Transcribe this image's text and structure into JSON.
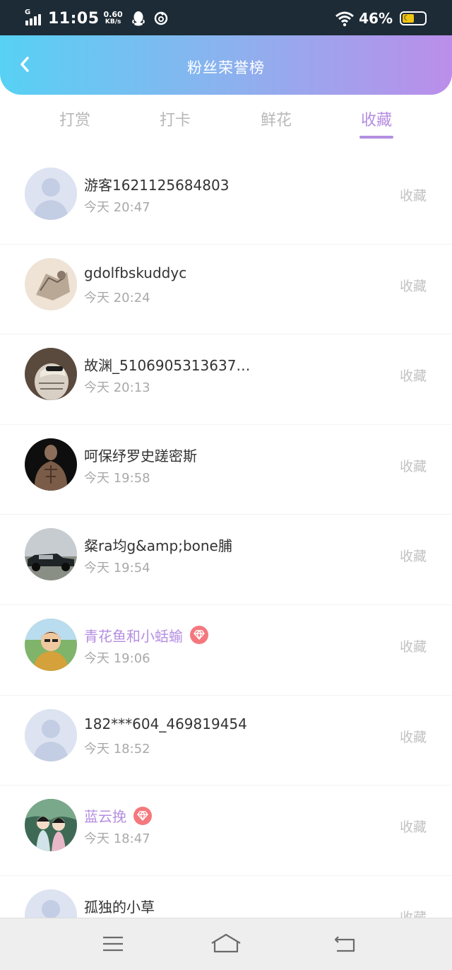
{
  "status_bar": {
    "network": "G",
    "time": "11:05",
    "speed_value": "0.60",
    "speed_unit": "KB/s",
    "battery": "46%"
  },
  "header": {
    "title": "粉丝荣誉榜"
  },
  "tabs": [
    {
      "label": "打赏",
      "active": false
    },
    {
      "label": "打卡",
      "active": false
    },
    {
      "label": "鲜花",
      "active": false
    },
    {
      "label": "收藏",
      "active": true
    }
  ],
  "list": [
    {
      "name": "游客1621125684803",
      "time": "今天 20:47",
      "action": "收藏",
      "vip": false
    },
    {
      "name": "gdolfbskuddyc",
      "time": "今天 20:24",
      "action": "收藏",
      "vip": false
    },
    {
      "name": "故渊_5106905313637…",
      "time": "今天 20:13",
      "action": "收藏",
      "vip": false
    },
    {
      "name": "呵保纾罗史蹉密斯",
      "time": "今天 19:58",
      "action": "收藏",
      "vip": false
    },
    {
      "name": "粲ra均g&amp;bone脯",
      "time": "今天 19:54",
      "action": "收藏",
      "vip": false
    },
    {
      "name": "青花鱼和小蛞蝓",
      "time": "今天 19:06",
      "action": "收藏",
      "vip": true
    },
    {
      "name": "182***604_469819454",
      "time": "今天 18:52",
      "action": "收藏",
      "vip": false
    },
    {
      "name": "蓝云挽",
      "time": "今天 18:47",
      "action": "收藏",
      "vip": true
    },
    {
      "name": "孤独的小草",
      "time": "",
      "action": "收藏",
      "vip": false
    }
  ],
  "colors": {
    "accent": "#b48ee0",
    "header_gradient_start": "#57d1f4",
    "header_gradient_end": "#bb8eea",
    "vip_badge": "#f4787d",
    "status_bar": "#1d2b36"
  },
  "icons": {
    "back": "chevron-left-icon",
    "vip": "diamond-icon",
    "nav_menu": "menu-icon",
    "nav_home": "home-icon",
    "nav_back": "return-icon"
  }
}
